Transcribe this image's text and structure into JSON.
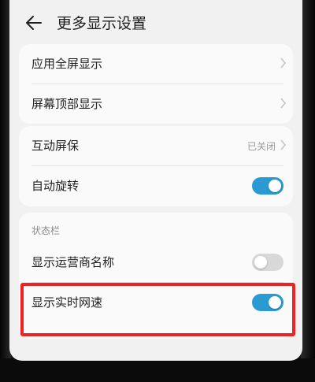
{
  "header": {
    "title": "更多显示设置",
    "back_icon": "arrow-left-icon"
  },
  "group1": {
    "items": [
      {
        "label": "应用全屏显示",
        "icon": "chevron-right-icon"
      },
      {
        "label": "屏幕顶部显示",
        "icon": "chevron-right-icon"
      }
    ]
  },
  "group2": {
    "screensaver": {
      "label": "互动屏保",
      "value": "已关闭",
      "icon": "chevron-right-icon"
    },
    "rotate": {
      "label": "自动旋转",
      "enabled": true
    }
  },
  "status_bar": {
    "header": "状态栏",
    "carrier": {
      "label": "显示运营商名称",
      "enabled": false
    },
    "network_speed": {
      "label": "显示实时网速",
      "enabled": true
    }
  },
  "colors": {
    "toggle_on": "#2a9bd2",
    "toggle_off": "#d8d8d8",
    "highlight": "#ee2222"
  }
}
